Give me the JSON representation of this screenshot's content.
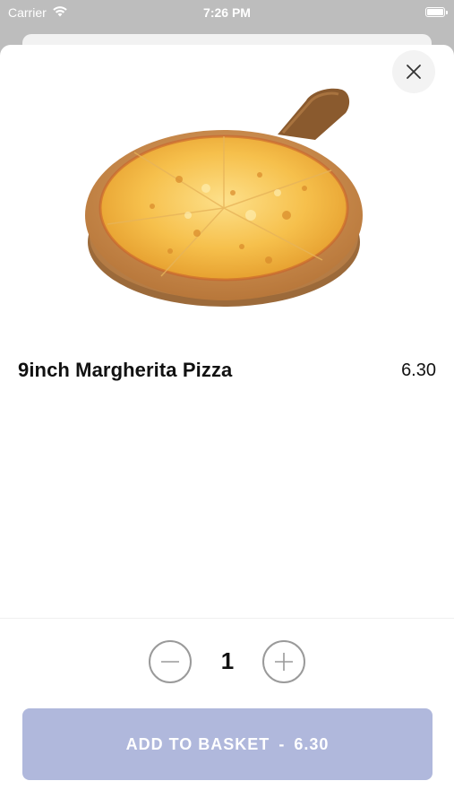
{
  "status_bar": {
    "carrier": "Carrier",
    "time": "7:26 PM",
    "wifi_icon": "wifi-icon",
    "battery_icon": "battery-icon"
  },
  "close_button": {
    "icon": "close-icon"
  },
  "product": {
    "name": "9inch Margherita Pizza",
    "price": "6.30",
    "image_icon": "pizza-image"
  },
  "quantity": {
    "value": "1",
    "minus_icon": "minus-icon",
    "plus_icon": "plus-icon"
  },
  "add_to_basket": {
    "label": "ADD TO BASKET",
    "separator": "-",
    "total": "6.30"
  },
  "colors": {
    "button_disabled": "#b0b8dc",
    "text": "#111111",
    "background_overlay": "#bdbdbd"
  }
}
